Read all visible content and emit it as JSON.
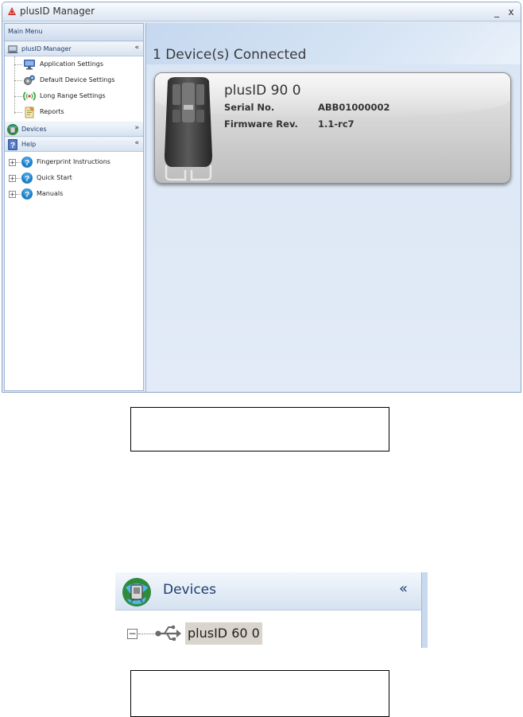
{
  "window": {
    "title": "plusID Manager",
    "minimize_label": "_",
    "close_label": "x"
  },
  "sidebar": {
    "main_menu": "Main Menu",
    "panels": [
      {
        "label": "plusID Manager",
        "expanded": true,
        "items": [
          {
            "label": "Application Settings",
            "icon": "monitor-icon"
          },
          {
            "label": "Default Device Settings",
            "icon": "gears-icon"
          },
          {
            "label": "Long Range Settings",
            "icon": "antenna-icon"
          },
          {
            "label": "Reports",
            "icon": "report-icon"
          }
        ]
      },
      {
        "label": "Devices",
        "expanded": false,
        "items": []
      },
      {
        "label": "Help",
        "expanded": true,
        "items": [
          {
            "label": "Fingerprint Instructions",
            "icon": "help-icon"
          },
          {
            "label": "Quick Start",
            "icon": "help-icon"
          },
          {
            "label": "Manuals",
            "icon": "help-icon"
          }
        ]
      }
    ]
  },
  "main": {
    "status": "1 Device(s) Connected",
    "device": {
      "name": "plusID 90 0",
      "serial_label": "Serial No.",
      "serial_value": "ABB01000002",
      "firmware_label": "Firmware Rev.",
      "firmware_value": "1.1-rc7"
    }
  },
  "devices_snippet": {
    "header": "Devices",
    "device_name": "plusID 60 0",
    "expander": "−"
  },
  "colors": {
    "frame_blue": "#9fb5d2",
    "content_blue": "#dce7f5",
    "header_text": "#1e3d6e",
    "card_grey": "#d9d9d9"
  }
}
